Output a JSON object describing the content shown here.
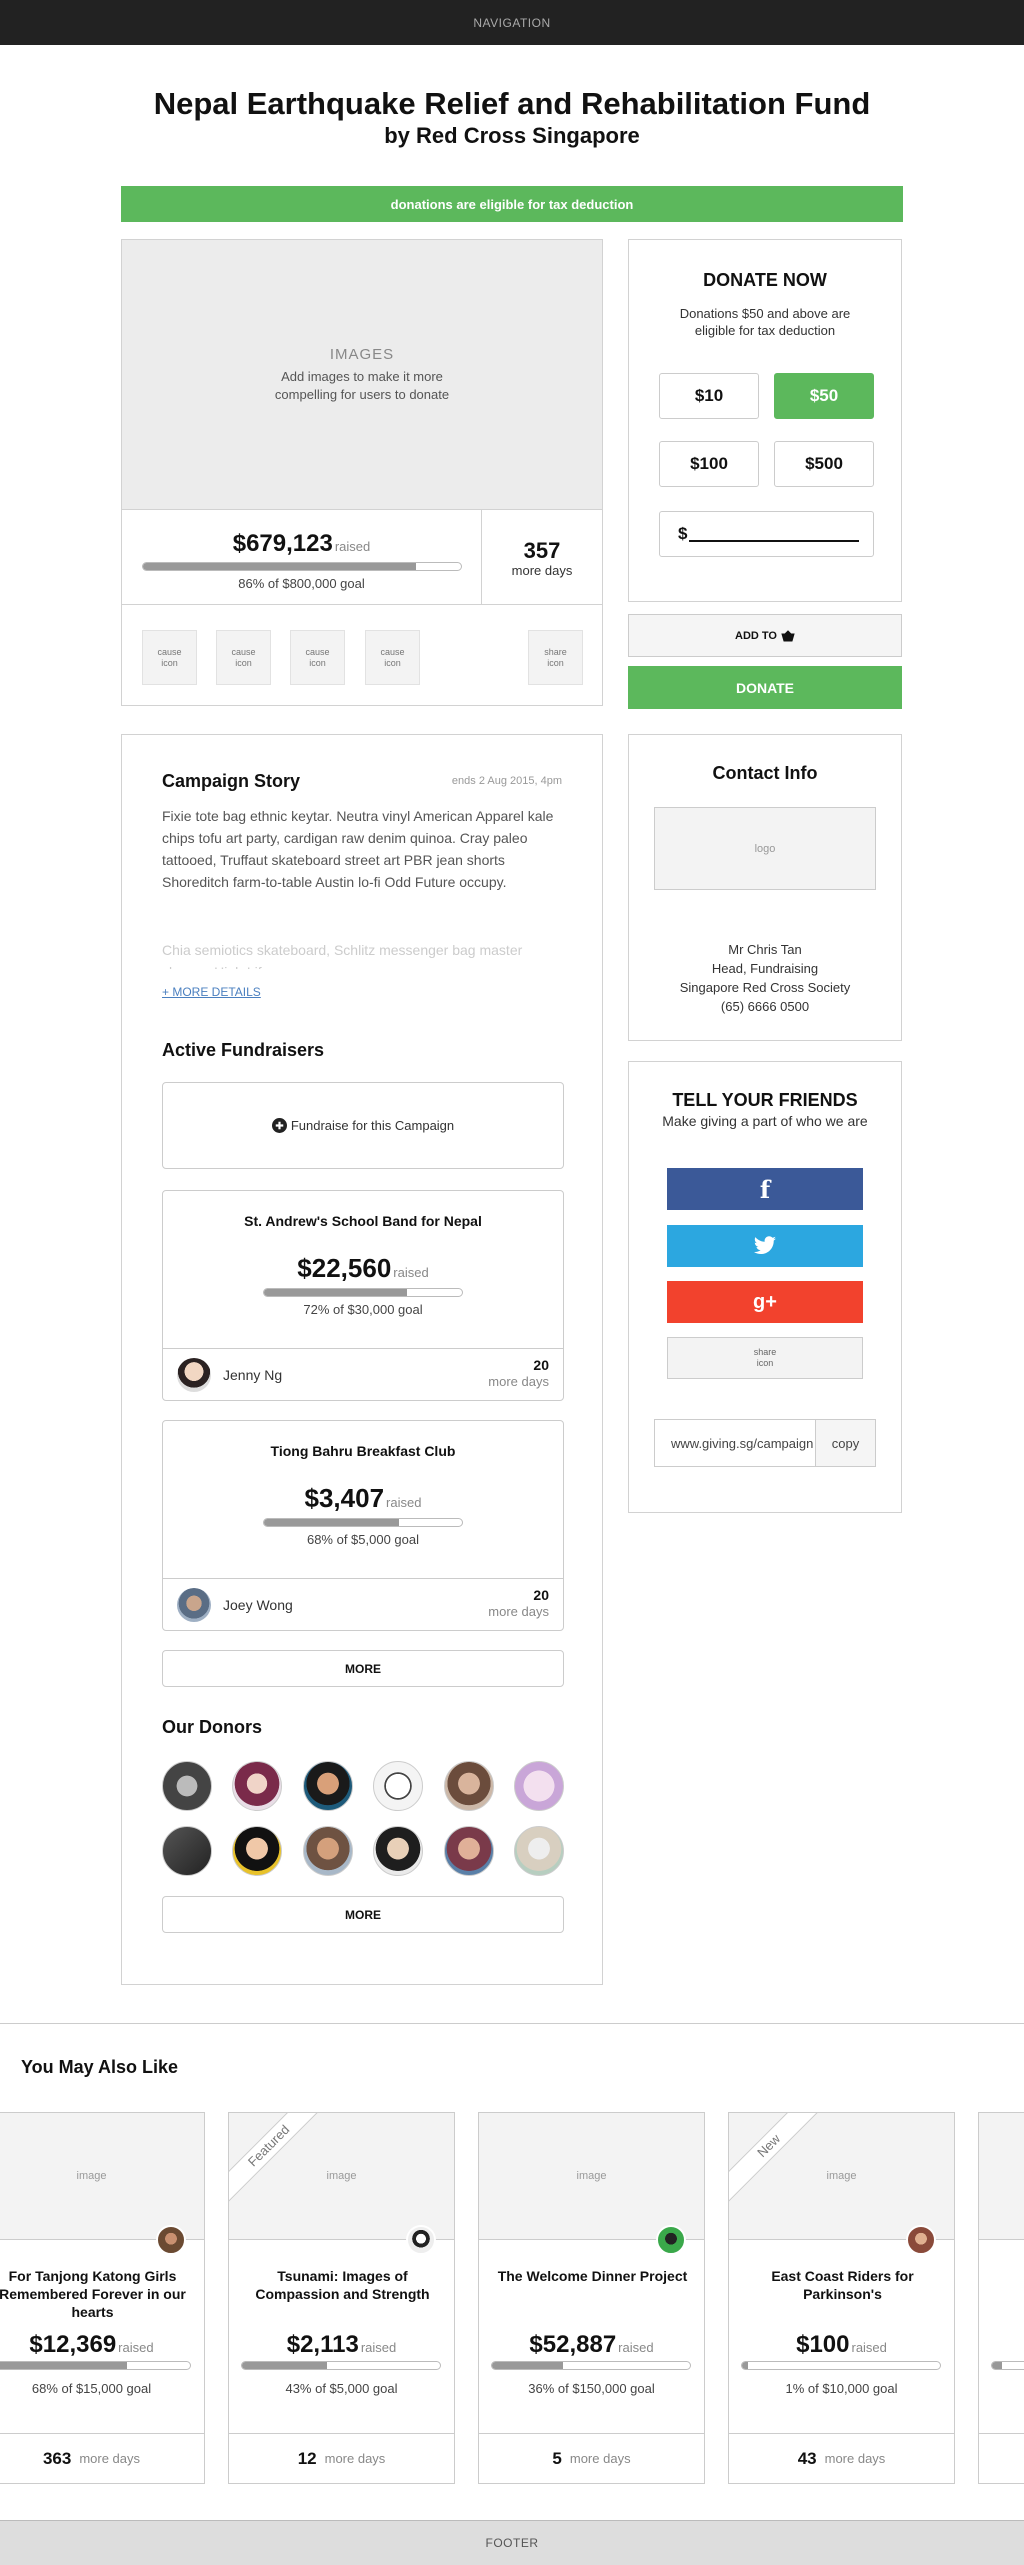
{
  "nav": {
    "label": "NAVIGATION"
  },
  "header": {
    "title": "Nepal Earthquake Relief and Rehabilitation Fund",
    "subtitle": "by Red Cross Singapore"
  },
  "tax_banner": "donations are eligible for tax deduction",
  "campaign": {
    "images_title": "IMAGES",
    "images_hint": "Add images to make it more compelling for users to donate",
    "amount": "$679,123",
    "raised_label": "raised",
    "progress_pct": 86,
    "goal_text": "86% of $800,000 goal",
    "days_left": "357",
    "days_label": "more days",
    "cause_icons": [
      "cause icon",
      "cause icon",
      "cause icon",
      "cause icon"
    ],
    "share_icon": "share icon"
  },
  "donate": {
    "title": "DONATE NOW",
    "note": "Donations $50 and above are eligible for tax deduction",
    "amounts": [
      "$10",
      "$50",
      "$100",
      "$500"
    ],
    "selected": "$50",
    "custom_prefix": "$",
    "add_to": "ADD TO",
    "donate_label": "DONATE"
  },
  "story": {
    "title": "Campaign Story",
    "ends": "ends 2 Aug 2015, 4pm",
    "p1": "Fixie tote bag ethnic keytar. Neutra vinyl American Apparel kale chips tofu art party, cardigan raw denim quinoa. Cray paleo tattooed, Truffaut skateboard street art PBR jean shorts Shoreditch farm-to-table Austin lo-fi Odd Future occupy.",
    "p2": "Chia semiotics skateboard, Schlitz messenger bag master cleanse High Life",
    "more": "+ MORE DETAILS"
  },
  "fundraisers": {
    "title": "Active Fundraisers",
    "cta": "Fundraise for this Campaign",
    "items": [
      {
        "name": "St. Andrew's School Band for Nepal",
        "amount": "$22,560",
        "raised": "raised",
        "pct": 72,
        "goal": "72% of $30,000 goal",
        "owner": "Jenny Ng",
        "days": "20",
        "days_label": "more days"
      },
      {
        "name": "Tiong Bahru Breakfast Club",
        "amount": "$3,407",
        "raised": "raised",
        "pct": 68,
        "goal": "68% of $5,000 goal",
        "owner": "Joey Wong",
        "days": "20",
        "days_label": "more days"
      }
    ],
    "more": "MORE"
  },
  "donors": {
    "title": "Our Donors",
    "more": "MORE"
  },
  "contact": {
    "title": "Contact Info",
    "logo": "logo",
    "name": "Mr Chris Tan",
    "role": "Head,  Fundraising",
    "org": "Singapore Red Cross Society",
    "phone": "(65) 6666 0500"
  },
  "tell": {
    "title": "TELL YOUR FRIENDS",
    "subtitle": "Make giving a part of who we are",
    "fb": "f",
    "tw": "t",
    "gp": "g+",
    "share": "share icon",
    "url": "www.giving.sg/campaign",
    "copy": "copy",
    "colors": {
      "facebook": "#3b5998",
      "twitter": "#2ca7e0",
      "google": "#f2422d"
    }
  },
  "also_like": {
    "title": "You May Also Like",
    "cards": [
      {
        "image": "image",
        "title": "For Tanjong Katong Girls Remembered Forever in our hearts",
        "amount": "$12,369",
        "raised": "raised",
        "pct": 68,
        "goal": "68% of $15,000 goal",
        "days": "363",
        "days_label": "more days",
        "ribbon": ""
      },
      {
        "image": "image",
        "title": "Tsunami: Images of Compassion and Strength",
        "amount": "$2,113",
        "raised": "raised",
        "pct": 43,
        "goal": "43% of $5,000 goal",
        "days": "12",
        "days_label": "more days",
        "ribbon": "Featured"
      },
      {
        "image": "image",
        "title": "The Welcome Dinner Project",
        "amount": "$52,887",
        "raised": "raised",
        "pct": 36,
        "goal": "36% of $150,000 goal",
        "days": "5",
        "days_label": "more days",
        "ribbon": ""
      },
      {
        "image": "image",
        "title": "East Coast Riders for Parkinson's",
        "amount": "$100",
        "raised": "raised",
        "pct": 1,
        "goal": "1% of $10,000 goal",
        "days": "43",
        "days_label": "more days",
        "ribbon": "New"
      }
    ]
  },
  "footer": {
    "label": "FOOTER"
  },
  "colors": {
    "accent_green": "#5cb85c",
    "nav_bg": "#222222"
  }
}
